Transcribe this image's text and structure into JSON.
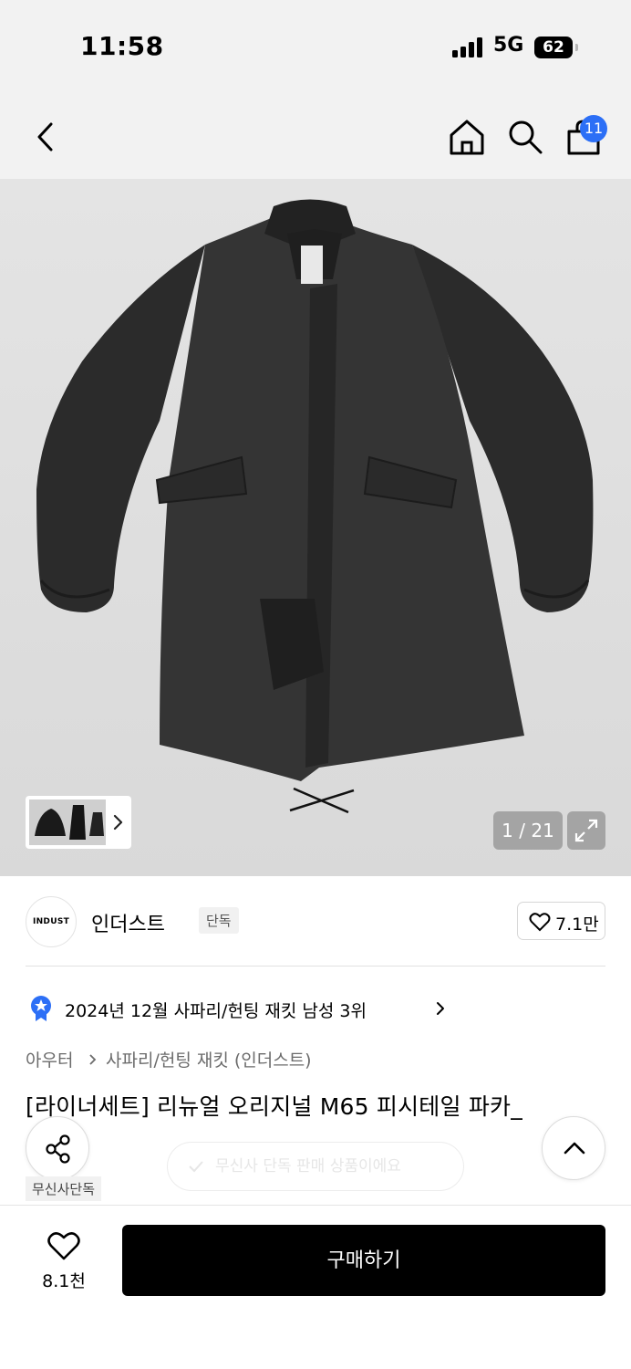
{
  "status_bar": {
    "time": "11:58",
    "network": "5G",
    "battery": "62"
  },
  "header": {
    "cart_badge": "11"
  },
  "gallery": {
    "counter": "1 / 21"
  },
  "brand": {
    "logo_text": "INDUST",
    "name": "인더스트",
    "tag": "단독",
    "likes": "7.1만"
  },
  "ranking": {
    "text": "2024년 12월 사파리/헌팅 재킷 남성 3위"
  },
  "breadcrumb": {
    "level1": "아우터",
    "level2": "사파리/헌팅 재킷 (인더스트)"
  },
  "product": {
    "title": "[라이너세트] 리뉴얼 오리지널 M65 피시테일 파카_",
    "exclusive_label": "무신사단독"
  },
  "toast": {
    "text": "무신사 단독 판매 상품이에요"
  },
  "bottom_bar": {
    "wish_count": "8.1천",
    "buy_label": "구매하기"
  },
  "colors": {
    "accent_badge": "#2c6ff6",
    "buy_button": "#000000"
  }
}
